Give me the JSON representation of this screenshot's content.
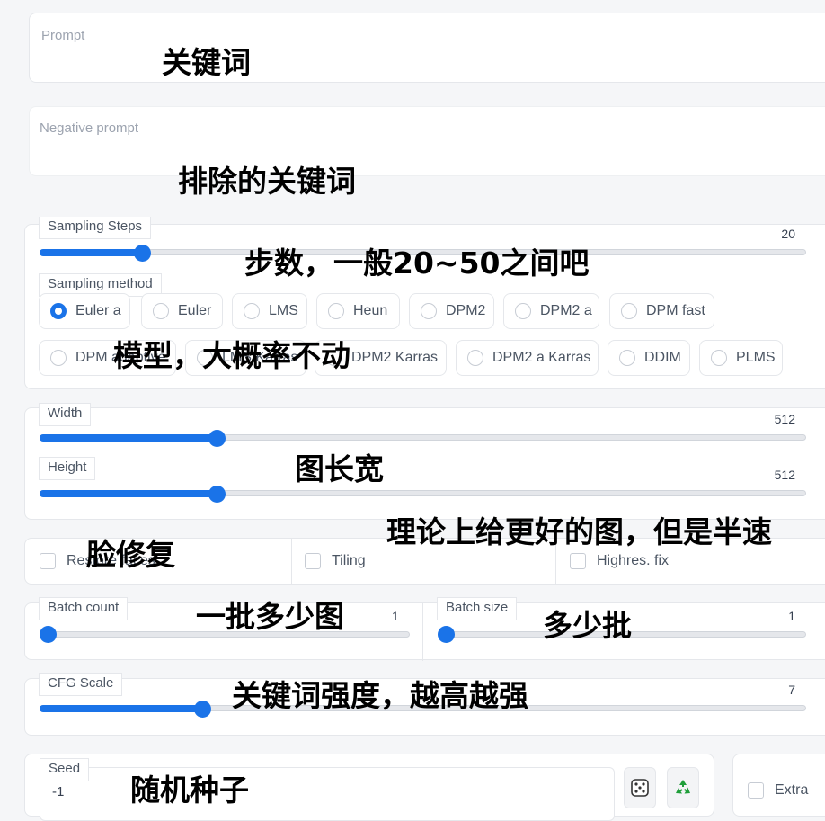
{
  "prompt": {
    "placeholder": "Prompt"
  },
  "negative_prompt": {
    "placeholder": "Negative prompt"
  },
  "sampling_steps": {
    "label": "Sampling Steps",
    "value": "20",
    "fraction": 0.14
  },
  "sampling_method": {
    "label": "Sampling method",
    "options_row1": [
      "Euler a",
      "Euler",
      "LMS",
      "Heun",
      "DPM2",
      "DPM2 a",
      "DPM fast"
    ],
    "options_row2": [
      "DPM adaptive",
      "LMS Karras",
      "DPM2 Karras",
      "DPM2 a Karras",
      "DDIM",
      "PLMS"
    ],
    "selected": "Euler a"
  },
  "width": {
    "label": "Width",
    "value": "512",
    "fraction": 0.23
  },
  "height": {
    "label": "Height",
    "value": "512",
    "fraction": 0.23
  },
  "checkboxes": {
    "restore_faces": "Restore faces",
    "tiling": "Tiling",
    "highres_fix": "Highres. fix"
  },
  "batch_count": {
    "label": "Batch count",
    "value": "1",
    "fraction": 0.0
  },
  "batch_size": {
    "label": "Batch size",
    "value": "1",
    "fraction": 0.0
  },
  "cfg_scale": {
    "label": "CFG Scale",
    "value": "7",
    "fraction": 0.21
  },
  "seed": {
    "label": "Seed",
    "value": "-1"
  },
  "extra": {
    "label": "Extra"
  },
  "icons": {
    "random_seed": "dice-icon",
    "reuse_seed": "recycle-icon"
  },
  "annotations": {
    "prompt": "关键词",
    "negative_prompt": "排除的关键词",
    "steps": "步数，一般20~50之间吧",
    "method": "模型，大概率不动",
    "size": "图长宽",
    "highres": "理论上给更好的图，但是半速",
    "face": "脸修复",
    "batch_count": "一批多少图",
    "batch_size": "多少批",
    "cfg": "关键词强度，越高越强",
    "seed": "随机种子"
  },
  "colors": {
    "accent": "#1a73e8",
    "border": "#e5e7eb",
    "background": "#f5f6f8"
  }
}
